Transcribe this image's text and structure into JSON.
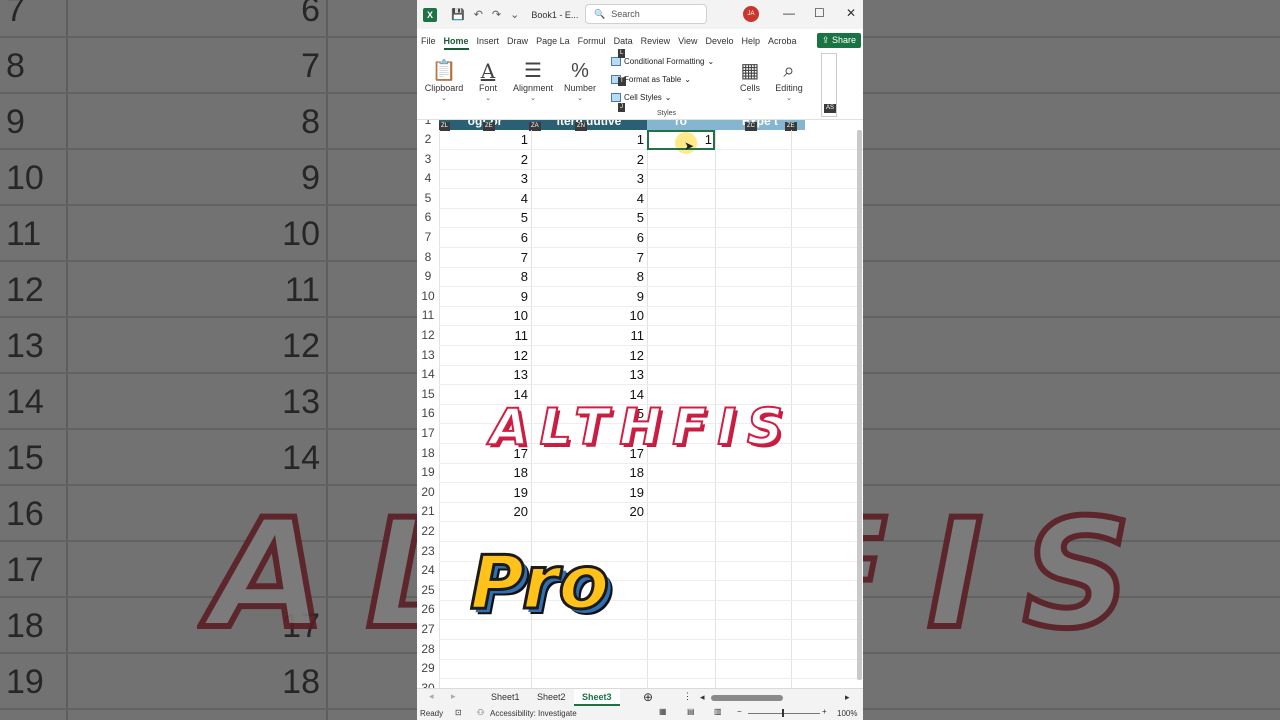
{
  "background": {
    "row_numbers": [
      "7",
      "8",
      "9",
      "10",
      "11",
      "12",
      "13",
      "14",
      "15",
      "16",
      "17",
      "18",
      "19"
    ],
    "values": [
      "6",
      "7",
      "8",
      "9",
      "10",
      "11",
      "12",
      "13",
      "14",
      "",
      "",
      "17",
      "18"
    ],
    "watermark": "ALTHFIS"
  },
  "titlebar": {
    "app_icon": "X",
    "book_title": "Book1 - E...",
    "search_placeholder": "Search",
    "user_initials": "JA",
    "minimize": "—",
    "maximize": "☐",
    "close": "✕"
  },
  "ribbon_tabs": [
    "File",
    "Home",
    "Insert",
    "Draw",
    "Page La",
    "Formul",
    "Data",
    "Review",
    "View",
    "Develo",
    "Help",
    "Acroba"
  ],
  "share_label": "Share",
  "ribbon": {
    "clipboard": "Clipboard",
    "font": "Font",
    "alignment": "Alignment",
    "number": "Number",
    "conditional_formatting": "Conditional Formatting",
    "format_as_table": "Format as Table",
    "cell_styles": "Cell Styles",
    "styles_group": "Styles",
    "cells": "Cells",
    "editing": "Editing"
  },
  "keytips": [
    "L",
    "T",
    "J",
    "ZL",
    "ZE",
    "ZA",
    "ZN",
    "ZC",
    "ZE",
    "AS"
  ],
  "header_row_text": [
    "ogr or",
    "ltern uutive",
    "ro",
    "Expe t"
  ],
  "rows": [
    {
      "n": "2",
      "a": "1",
      "b": "1",
      "c": "1"
    },
    {
      "n": "3",
      "a": "2",
      "b": "2",
      "c": ""
    },
    {
      "n": "4",
      "a": "3",
      "b": "3",
      "c": ""
    },
    {
      "n": "5",
      "a": "4",
      "b": "4",
      "c": ""
    },
    {
      "n": "6",
      "a": "5",
      "b": "5",
      "c": ""
    },
    {
      "n": "7",
      "a": "6",
      "b": "6",
      "c": ""
    },
    {
      "n": "8",
      "a": "7",
      "b": "7",
      "c": ""
    },
    {
      "n": "9",
      "a": "8",
      "b": "8",
      "c": ""
    },
    {
      "n": "10",
      "a": "9",
      "b": "9",
      "c": ""
    },
    {
      "n": "11",
      "a": "10",
      "b": "10",
      "c": ""
    },
    {
      "n": "12",
      "a": "11",
      "b": "11",
      "c": ""
    },
    {
      "n": "13",
      "a": "12",
      "b": "12",
      "c": ""
    },
    {
      "n": "14",
      "a": "13",
      "b": "13",
      "c": ""
    },
    {
      "n": "15",
      "a": "14",
      "b": "14",
      "c": ""
    },
    {
      "n": "16",
      "a": "",
      "b": "15",
      "c": ""
    },
    {
      "n": "17",
      "a": "",
      "b": "",
      "c": ""
    },
    {
      "n": "18",
      "a": "17",
      "b": "17",
      "c": ""
    },
    {
      "n": "19",
      "a": "18",
      "b": "18",
      "c": ""
    },
    {
      "n": "20",
      "a": "19",
      "b": "19",
      "c": ""
    },
    {
      "n": "21",
      "a": "20",
      "b": "20",
      "c": ""
    },
    {
      "n": "22",
      "a": "",
      "b": "",
      "c": ""
    },
    {
      "n": "23",
      "a": "",
      "b": "",
      "c": ""
    },
    {
      "n": "24",
      "a": "",
      "b": "",
      "c": ""
    },
    {
      "n": "25",
      "a": "",
      "b": "",
      "c": ""
    },
    {
      "n": "26",
      "a": "",
      "b": "",
      "c": ""
    },
    {
      "n": "27",
      "a": "",
      "b": "",
      "c": ""
    },
    {
      "n": "28",
      "a": "",
      "b": "",
      "c": ""
    },
    {
      "n": "29",
      "a": "",
      "b": "",
      "c": ""
    },
    {
      "n": "30",
      "a": "",
      "b": "",
      "c": ""
    }
  ],
  "row1_header": "1",
  "overlay": {
    "brand": "ALTHFIS",
    "pro": "Pro"
  },
  "sheets": [
    "Sheet1",
    "Sheet2",
    "Sheet3"
  ],
  "active_sheet": "Sheet3",
  "status": {
    "ready": "Ready",
    "accessibility": "Accessibility: Investigate",
    "zoom": "100%"
  }
}
